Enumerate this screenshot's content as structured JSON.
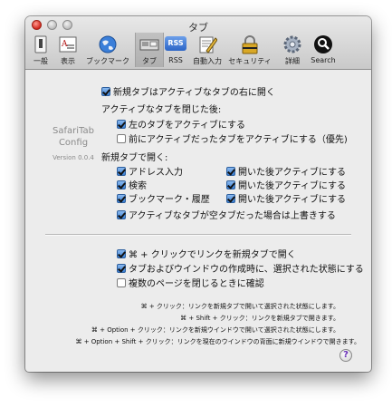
{
  "window": {
    "title": "タブ"
  },
  "toolbar": {
    "items": [
      {
        "label": "一般",
        "icon": "switch-icon"
      },
      {
        "label": "表示",
        "icon": "font-icon"
      },
      {
        "label": "ブックマーク",
        "icon": "globe-icon"
      },
      {
        "label": "タブ",
        "icon": "tabs-icon",
        "selected": true
      },
      {
        "label": "RSS",
        "icon": "rss-icon"
      },
      {
        "label": "自動入力",
        "icon": "pencil-icon"
      },
      {
        "label": "セキュリティ",
        "icon": "lock-icon"
      },
      {
        "label": "詳細",
        "icon": "gear-icon"
      },
      {
        "label": "Search",
        "icon": "magnifier-icon"
      }
    ],
    "rss_badge": "RSS"
  },
  "sidebar": {
    "name_line1": "SafariTab",
    "name_line2": "Config",
    "version": "Version 0.0.4"
  },
  "options": {
    "new_tab_right": {
      "label": "新規タブはアクティブなタブの右に開く",
      "checked": true
    },
    "close_header": "アクティブなタブを閉じた後:",
    "close_left": {
      "label": "左のタブをアクティブにする",
      "checked": true
    },
    "close_previous": {
      "label": "前にアクティブだったタブをアクティブにする（優先)",
      "checked": false
    },
    "open_header": "新規タブで開く:",
    "address": {
      "label": "アドレス入力",
      "checked": true
    },
    "search": {
      "label": "検索",
      "checked": true
    },
    "bookmark": {
      "label": "ブックマーク・履歴",
      "checked": true
    },
    "address_activate": {
      "label": "開いた後アクティブにする",
      "checked": true
    },
    "search_activate": {
      "label": "開いた後アクティブにする",
      "checked": true
    },
    "bookmark_activate": {
      "label": "開いた後アクティブにする",
      "checked": true
    },
    "overwrite_empty": {
      "label": "アクティブなタブが空タブだった場合は上書きする",
      "checked": true
    },
    "cmd_click": {
      "label": "⌘ + クリックでリンクを新規タブで開く",
      "checked": true
    },
    "select_on_create": {
      "label": "タブおよびウインドウの作成時に、選択された状態にする",
      "checked": true
    },
    "confirm_close": {
      "label": "複数のページを閉じるときに確認",
      "checked": false
    }
  },
  "notes": [
    "⌘ + クリック：リンクを新規タブで開いて選択された状態にします。",
    "⌘ + Shift + クリック：リンクを新規タブで開きます。",
    "⌘ + Option + クリック：リンクを新規ウインドウで開いて選択された状態にします。",
    "⌘ + Option + Shift + クリック：リンクを現在のウインドウの背面に新規ウインドウで開きます。"
  ],
  "help": {
    "symbol": "?"
  }
}
